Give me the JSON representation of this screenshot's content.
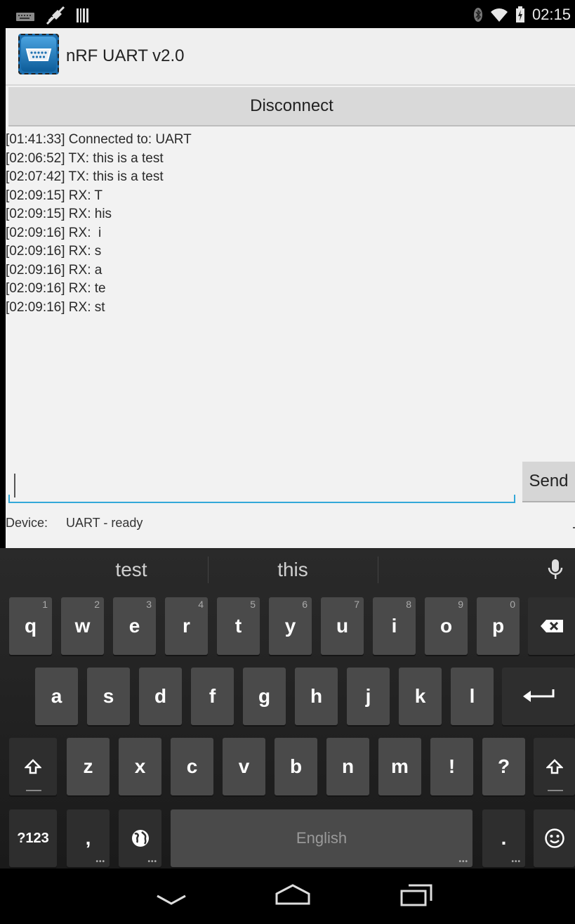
{
  "status_bar": {
    "time": "02:15",
    "icons": [
      "keyboard-icon",
      "usb-debug-icon",
      "barcode-icon",
      "bluetooth-icon",
      "wifi-icon",
      "battery-charging-icon"
    ]
  },
  "app": {
    "title": "nRF UART v2.0",
    "icon": "serial-port-icon"
  },
  "main": {
    "disconnect_label": "Disconnect",
    "log": [
      "[01:41:33] Connected to: UART",
      "[02:06:52] TX: this is a test",
      "[02:07:42] TX: this is a test",
      "[02:09:15] RX: T",
      "[02:09:15] RX: his",
      "[02:09:16] RX:  i",
      "[02:09:16] RX: s",
      "[02:09:16] RX: a",
      "[02:09:16] RX: te",
      "[02:09:16] RX: st"
    ],
    "input_value": "",
    "send_label": "Send",
    "device_label": "Device:",
    "device_status": "UART - ready"
  },
  "keyboard": {
    "suggestions": [
      "test",
      "this"
    ],
    "row1": [
      {
        "label": "q",
        "hint": "1"
      },
      {
        "label": "w",
        "hint": "2"
      },
      {
        "label": "e",
        "hint": "3"
      },
      {
        "label": "r",
        "hint": "4"
      },
      {
        "label": "t",
        "hint": "5"
      },
      {
        "label": "y",
        "hint": "6"
      },
      {
        "label": "u",
        "hint": "7"
      },
      {
        "label": "i",
        "hint": "8"
      },
      {
        "label": "o",
        "hint": "9"
      },
      {
        "label": "p",
        "hint": "0"
      }
    ],
    "row2": [
      "a",
      "s",
      "d",
      "f",
      "g",
      "h",
      "j",
      "k",
      "l"
    ],
    "row3": [
      "z",
      "x",
      "c",
      "v",
      "b",
      "n",
      "m",
      "!",
      "?"
    ],
    "symbols_label": "?123",
    "comma_label": ",",
    "space_label": "English",
    "period_label": "."
  }
}
